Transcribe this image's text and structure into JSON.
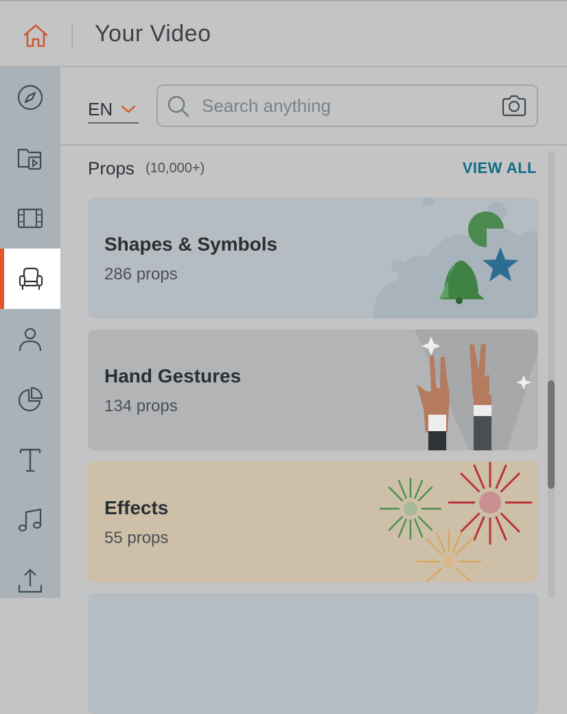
{
  "header": {
    "title": "Your Video",
    "home_icon": "home-icon"
  },
  "sidebar": {
    "items": [
      {
        "name": "compass",
        "icon": "compass-icon",
        "active": false
      },
      {
        "name": "media-folder",
        "icon": "folder-video-icon",
        "active": false
      },
      {
        "name": "film",
        "icon": "film-icon",
        "active": false
      },
      {
        "name": "props",
        "icon": "armchair-icon",
        "active": true
      },
      {
        "name": "characters",
        "icon": "person-icon",
        "active": false
      },
      {
        "name": "charts",
        "icon": "pie-chart-icon",
        "active": false
      },
      {
        "name": "text",
        "icon": "text-icon",
        "active": false
      },
      {
        "name": "music",
        "icon": "music-note-icon",
        "active": false
      },
      {
        "name": "upload",
        "icon": "upload-icon",
        "active": false
      }
    ],
    "accent": "#e2562a"
  },
  "toolbar": {
    "language": "EN",
    "search_placeholder": "Search anything",
    "search_value": ""
  },
  "section": {
    "title": "Props",
    "count": "(10,000+)",
    "view_all": "VIEW ALL",
    "link_color": "#0f6c84"
  },
  "cards": [
    {
      "title": "Shapes & Symbols",
      "count": "286 props",
      "bg": "#b5bcc2"
    },
    {
      "title": "Hand Gestures",
      "count": "134 props",
      "bg": "#b3b4b6"
    },
    {
      "title": "Effects",
      "count": "55 props",
      "bg": "#cdbfa8"
    }
  ]
}
